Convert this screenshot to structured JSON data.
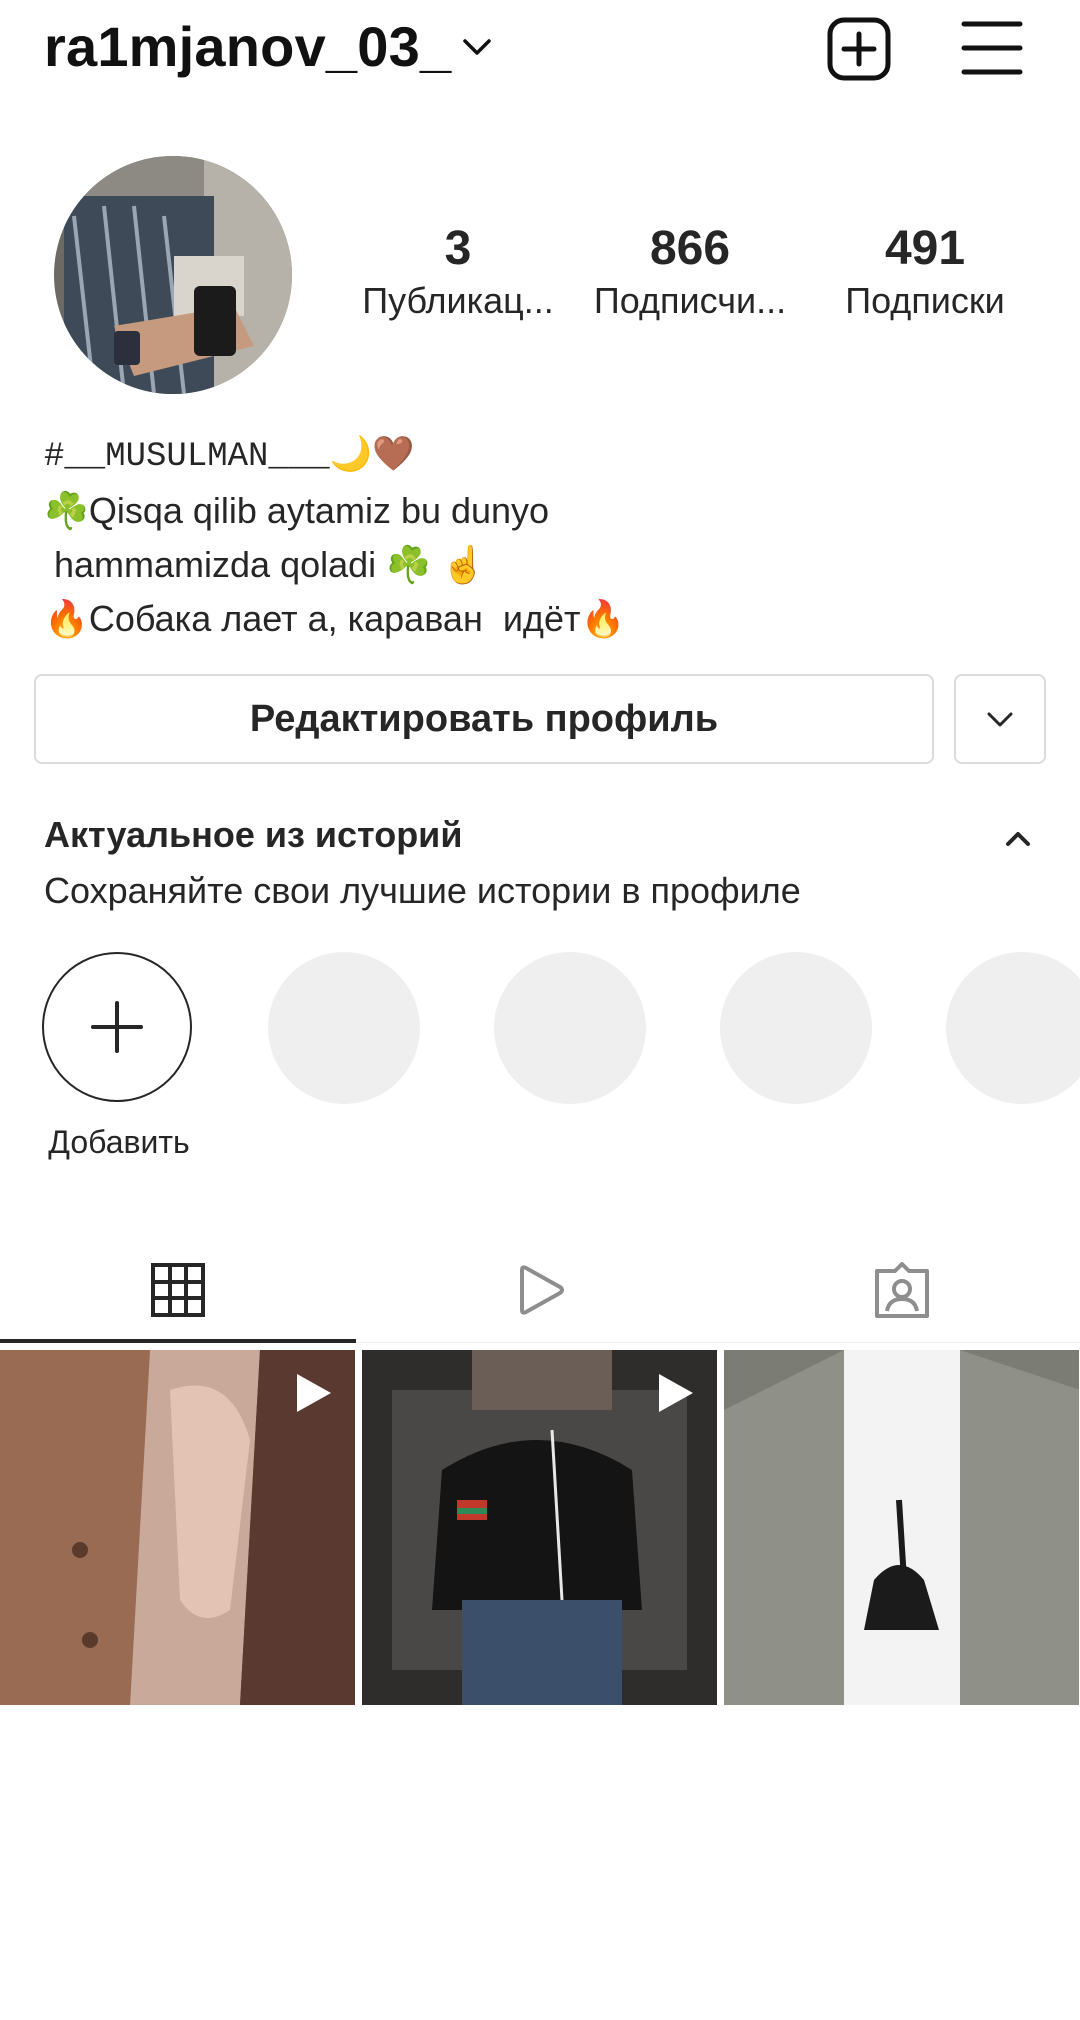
{
  "header": {
    "username": "ra1mjanov_03_",
    "icons": [
      "chevron-down-icon",
      "new-post-icon",
      "menu-icon"
    ]
  },
  "stats": [
    {
      "value": "3",
      "label": "Публикац..."
    },
    {
      "value": "866",
      "label": "Подписчи..."
    },
    {
      "value": "491",
      "label": "Подписки"
    }
  ],
  "bio": {
    "line1": "#__MUSULMAN___🌙🤎",
    "line2": "☘️Qisqa qilib aytamiz bu dunyo",
    "line3": " hammamizda qoladi ☘️ ☝️",
    "line4": "🔥Собака лает а, караван  идёт🔥"
  },
  "buttons": {
    "edit_profile": "Редактировать профиль"
  },
  "highlights": {
    "title": "Актуальное из историй",
    "subtitle": "Сохраняйте свои лучшие истории в профиле",
    "add_label": "Добавить"
  },
  "tabs": [
    {
      "icon": "grid-icon",
      "active": true
    },
    {
      "icon": "reels-icon",
      "active": false
    },
    {
      "icon": "tagged-icon",
      "active": false
    }
  ],
  "posts": [
    {
      "type": "reel",
      "icon": "play-icon"
    },
    {
      "type": "reel",
      "icon": "play-icon"
    },
    {
      "type": "image"
    }
  ],
  "colors": {
    "text": "#262626",
    "border": "#dbdbdb",
    "placeholder": "#efefef",
    "background": "#ffffff"
  }
}
